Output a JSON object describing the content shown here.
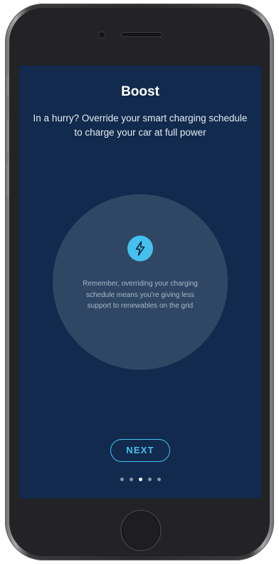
{
  "screen": {
    "title": "Boost",
    "subtitle": "In a hurry? Override your smart charging schedule to charge your car at full power",
    "info_icon": "lightning-bolt-icon",
    "info_text": "Remember, overriding your charging schedule means you're giving less support to renewables on the grid",
    "next_label": "NEXT"
  },
  "pagination": {
    "total": 5,
    "active_index": 2
  },
  "colors": {
    "background": "#112a4d",
    "circle": "#2f4765",
    "accent": "#45c1ee"
  }
}
